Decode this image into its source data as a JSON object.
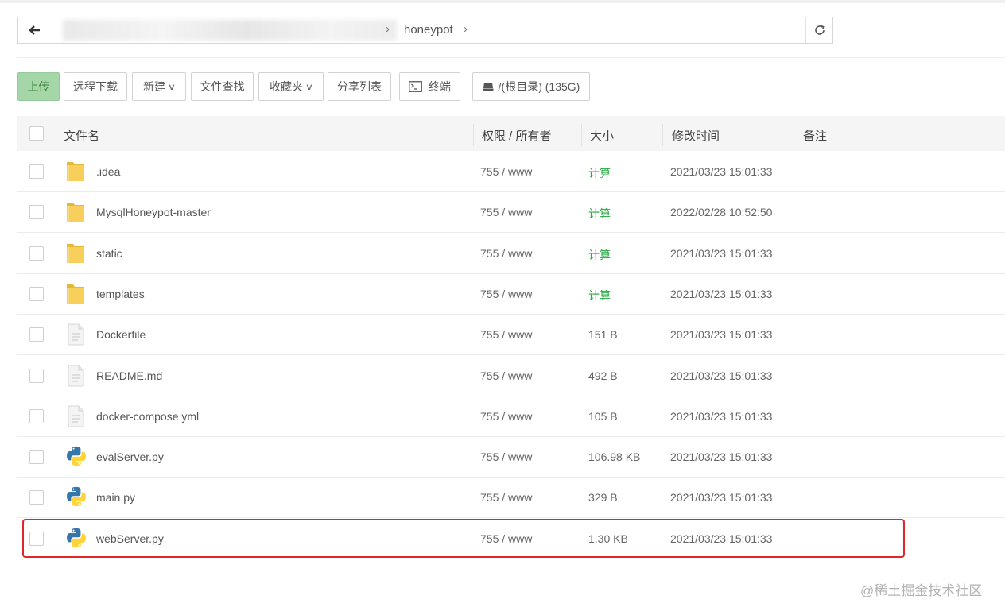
{
  "path": {
    "crumbs": [
      "honeypot"
    ],
    "separator": "›"
  },
  "toolbar": {
    "upload": "上传",
    "remote_download": "远程下载",
    "new": "新建",
    "file_search": "文件查找",
    "favorites": "收藏夹",
    "share_list": "分享列表",
    "terminal": "终端",
    "disk": "/(根目录) (135G)"
  },
  "table": {
    "headers": {
      "name": "文件名",
      "perm": "权限 / 所有者",
      "size": "大小",
      "mtime": "修改时间",
      "note": "备注"
    },
    "rows": [
      {
        "type": "folder",
        "name": ".idea",
        "perm": "755 / www",
        "size": "计算",
        "mtime": "2021/03/23 15:01:33"
      },
      {
        "type": "folder",
        "name": "MysqlHoneypot-master",
        "perm": "755 / www",
        "size": "计算",
        "mtime": "2022/02/28 10:52:50"
      },
      {
        "type": "folder",
        "name": "static",
        "perm": "755 / www",
        "size": "计算",
        "mtime": "2021/03/23 15:01:33"
      },
      {
        "type": "folder",
        "name": "templates",
        "perm": "755 / www",
        "size": "计算",
        "mtime": "2021/03/23 15:01:33"
      },
      {
        "type": "file",
        "name": "Dockerfile",
        "perm": "755 / www",
        "size": "151 B",
        "mtime": "2021/03/23 15:01:33"
      },
      {
        "type": "file",
        "name": "README.md",
        "perm": "755 / www",
        "size": "492 B",
        "mtime": "2021/03/23 15:01:33"
      },
      {
        "type": "file",
        "name": "docker-compose.yml",
        "perm": "755 / www",
        "size": "105 B",
        "mtime": "2021/03/23 15:01:33"
      },
      {
        "type": "python",
        "name": "evalServer.py",
        "perm": "755 / www",
        "size": "106.98 KB",
        "mtime": "2021/03/23 15:01:33"
      },
      {
        "type": "python",
        "name": "main.py",
        "perm": "755 / www",
        "size": "329 B",
        "mtime": "2021/03/23 15:01:33"
      },
      {
        "type": "python",
        "name": "webServer.py",
        "perm": "755 / www",
        "size": "1.30 KB",
        "mtime": "2021/03/23 15:01:33"
      }
    ]
  },
  "watermark": "@稀土掘金技术社区",
  "colors": {
    "upload_bg": "#a5d6a7",
    "calc_link": "#20a53a",
    "highlight_border": "#e0262a"
  }
}
